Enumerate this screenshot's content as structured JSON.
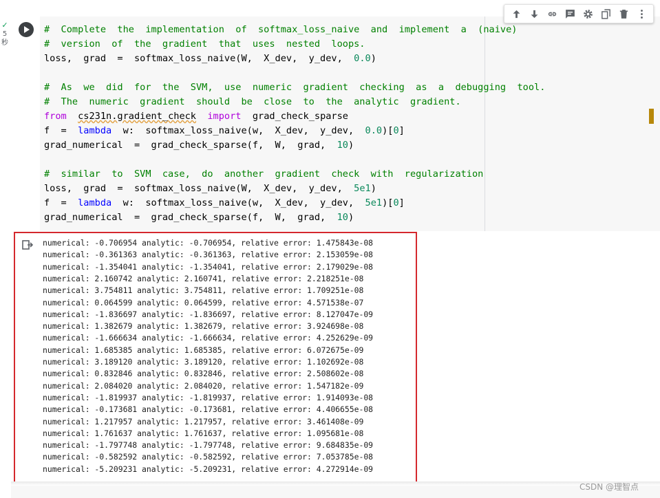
{
  "status": {
    "check": "✓",
    "exec_time": "5",
    "unit": "秒"
  },
  "toolbar": {
    "icons": [
      "arrow-up-icon",
      "arrow-down-icon",
      "link-icon",
      "comment-icon",
      "settings-icon",
      "mirror-cell-icon",
      "delete-icon",
      "more-icon"
    ]
  },
  "code": {
    "l1": "#  Complete  the  implementation  of  softmax_loss_naive  and  implement  a  (naive)",
    "l2": "#  version  of  the  gradient  that  uses  nested  loops.",
    "l3_a": "loss,  grad  =  softmax_loss_naive(W,  X_dev,  y_dev,  ",
    "l3_b": "0.0",
    "l3_c": ")",
    "l4": "#  As  we  did  for  the  SVM,  use  numeric  gradient  checking  as  a  debugging  tool.",
    "l5": "#  The  numeric  gradient  should  be  close  to  the  analytic  gradient.",
    "l6_from": "from",
    "l6_mod": "cs231n.gradient_check",
    "l6_import": "import",
    "l6_name": "grad_check_sparse",
    "l7_a": "f  =  ",
    "l7_lambda": "lambda",
    "l7_b": "  w:  softmax_loss_naive(w,  X_dev,  y_dev,  ",
    "l7_num": "0.0",
    "l7_c": ")[",
    "l7_idx": "0",
    "l7_d": "]",
    "l8_a": "grad_numerical  =  grad_check_sparse(f,  W,  grad,  ",
    "l8_num": "10",
    "l8_c": ")",
    "l9": "#  similar  to  SVM  case,  do  another  gradient  check  with  regularization",
    "l10_a": "loss,  grad  =  softmax_loss_naive(W,  X_dev,  y_dev,  ",
    "l10_num": "5e1",
    "l10_c": ")",
    "l11_a": "f  =  ",
    "l11_lambda": "lambda",
    "l11_b": "  w:  softmax_loss_naive(w,  X_dev,  y_dev,  ",
    "l11_num": "5e1",
    "l11_c": ")[",
    "l11_idx": "0",
    "l11_d": "]",
    "l12_a": "grad_numerical  =  grad_check_sparse(f,  W,  grad,  ",
    "l12_num": "10",
    "l12_c": ")"
  },
  "output": [
    "numerical: -0.706954 analytic: -0.706954, relative error: 1.475843e-08",
    "numerical: -0.361363 analytic: -0.361363, relative error: 2.153059e-08",
    "numerical: -1.354041 analytic: -1.354041, relative error: 2.179029e-08",
    "numerical: 2.160742 analytic: 2.160741, relative error: 2.218251e-08",
    "numerical: 3.754811 analytic: 3.754811, relative error: 1.709251e-08",
    "numerical: 0.064599 analytic: 0.064599, relative error: 4.571538e-07",
    "numerical: -1.836697 analytic: -1.836697, relative error: 8.127047e-09",
    "numerical: 1.382679 analytic: 1.382679, relative error: 3.924698e-08",
    "numerical: -1.666634 analytic: -1.666634, relative error: 4.252629e-09",
    "numerical: 1.685385 analytic: 1.685385, relative error: 6.072675e-09",
    "numerical: 3.189120 analytic: 3.189120, relative error: 1.102692e-08",
    "numerical: 0.832846 analytic: 0.832846, relative error: 2.508602e-08",
    "numerical: 2.084020 analytic: 2.084020, relative error: 1.547182e-09",
    "numerical: -1.819937 analytic: -1.819937, relative error: 1.914093e-08",
    "numerical: -0.173681 analytic: -0.173681, relative error: 4.406655e-08",
    "numerical: 1.217957 analytic: 1.217957, relative error: 3.461408e-09",
    "numerical: 1.761637 analytic: 1.761637, relative error: 1.095681e-08",
    "numerical: -1.797748 analytic: -1.797748, relative error: 9.684835e-09",
    "numerical: -0.582592 analytic: -0.582592, relative error: 7.053785e-08",
    "numerical: -5.209231 analytic: -5.209231, relative error: 4.272914e-09"
  ],
  "watermark": "CSDN @理智点"
}
